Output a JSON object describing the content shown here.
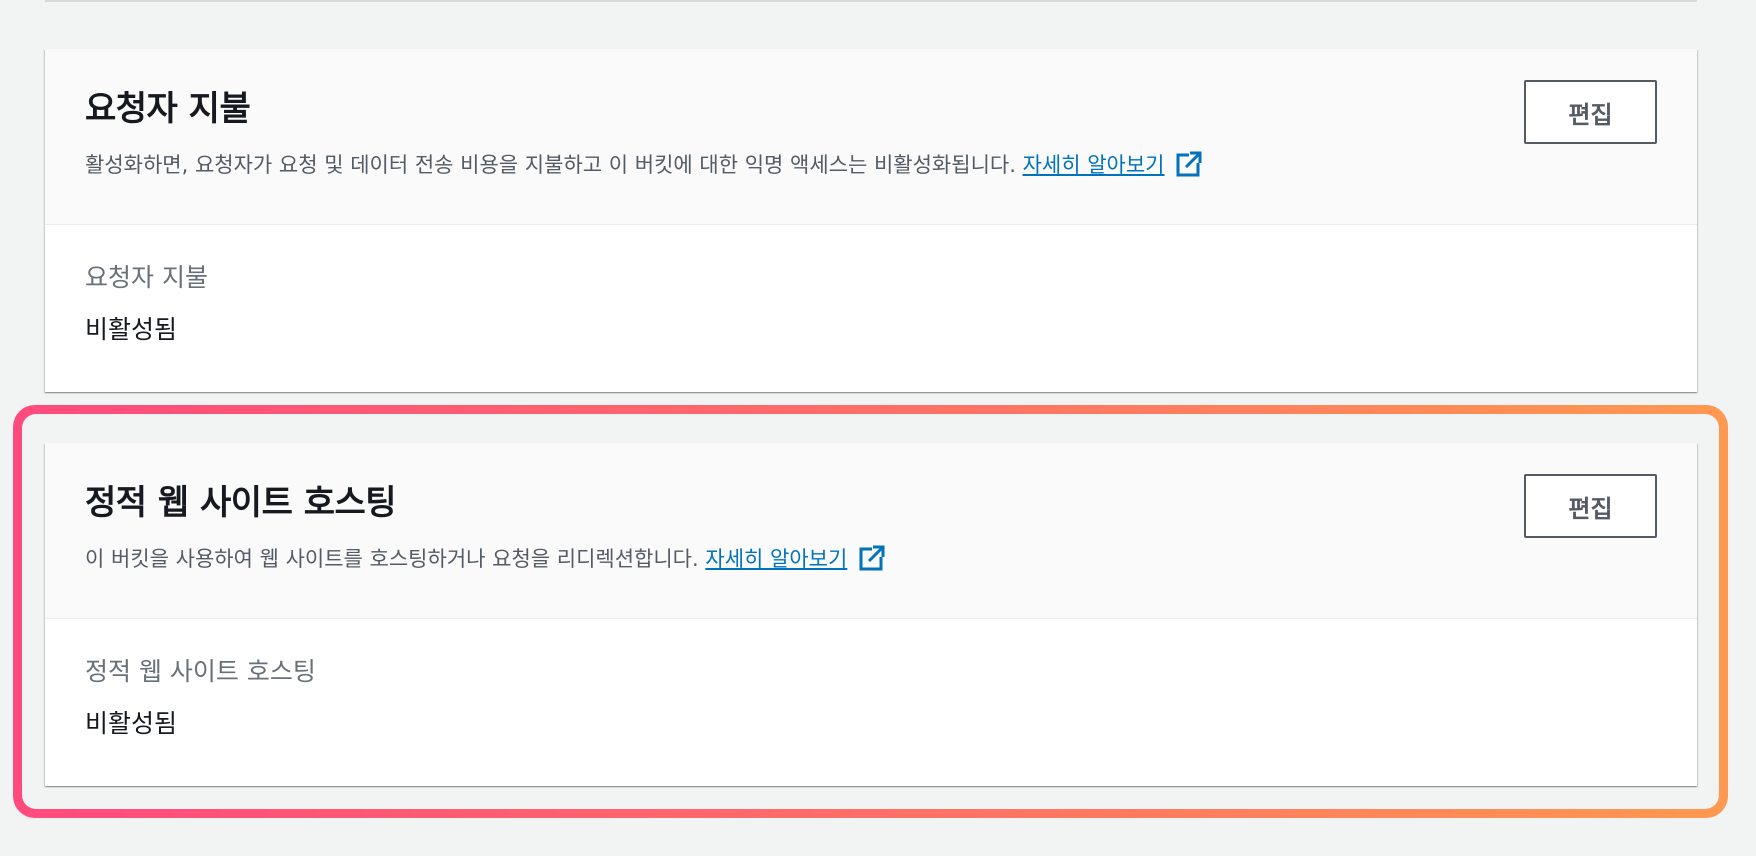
{
  "requester_pays": {
    "title": "요청자 지불",
    "description": "활성화하면, 요청자가 요청 및 데이터 전송 비용을 지불하고 이 버킷에 대한 익명 액세스는 비활성화됩니다.",
    "learn_more": "자세히 알아보기",
    "edit_label": "편집",
    "field_label": "요청자 지불",
    "field_value": "비활성됨"
  },
  "static_hosting": {
    "title": "정적 웹 사이트 호스팅",
    "description": "이 버킷을 사용하여 웹 사이트를 호스팅하거나 요청을 리디렉션합니다.",
    "learn_more": "자세히 알아보기",
    "edit_label": "편집",
    "field_label": "정적 웹 사이트 호스팅",
    "field_value": "비활성됨"
  },
  "icons": {
    "external": "external-link-icon"
  },
  "colors": {
    "link": "#0073bb",
    "highlight_start": "#ff4a7e",
    "highlight_end": "#ff9850",
    "page_bg": "#f2f3f3"
  }
}
